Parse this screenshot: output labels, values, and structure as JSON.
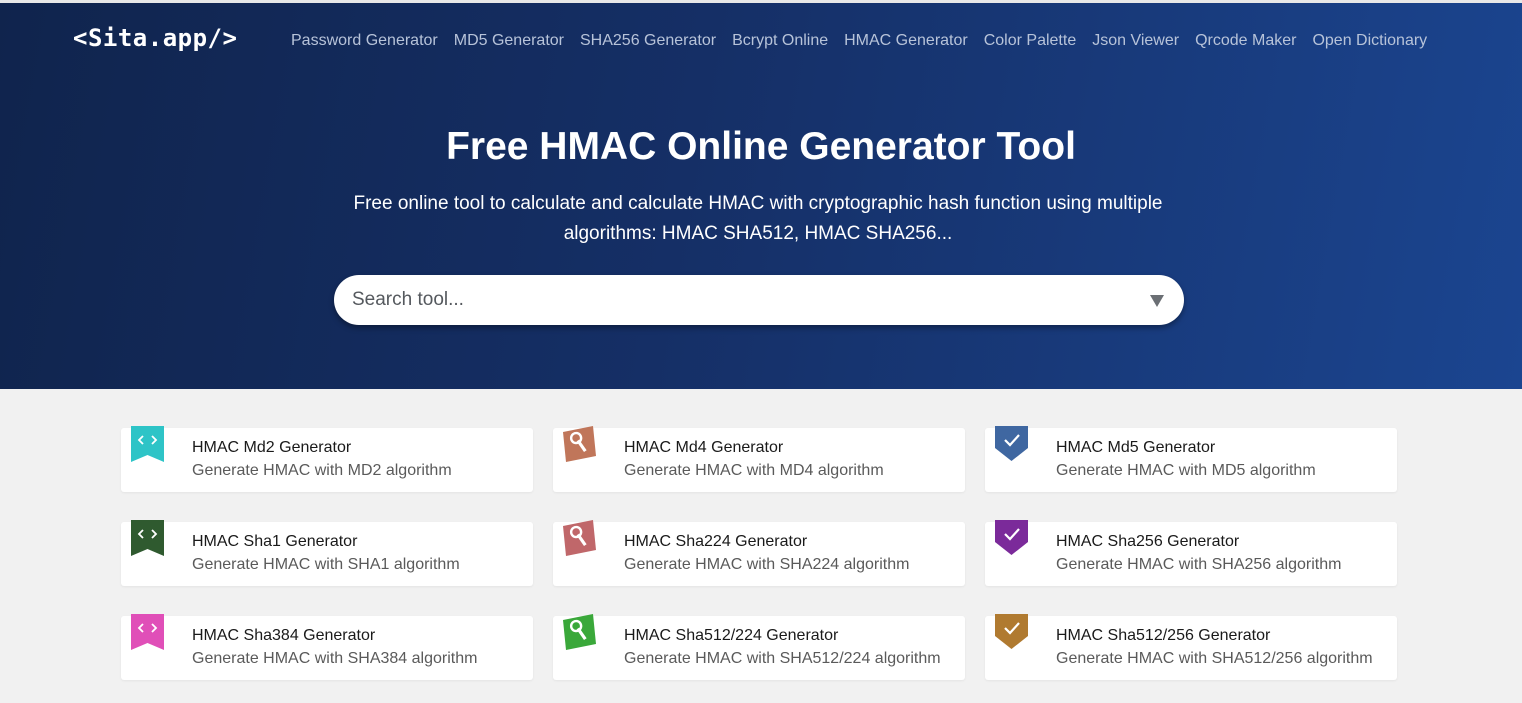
{
  "header": {
    "logo": "<Sita.app/>",
    "nav": [
      "Password Generator",
      "MD5 Generator",
      "SHA256 Generator",
      "Bcrypt Online",
      "HMAC Generator",
      "Color Palette",
      "Json Viewer",
      "Qrcode Maker",
      "Open Dictionary"
    ]
  },
  "hero": {
    "title": "Free HMAC Online Generator Tool",
    "subtitle_line1": "Free online tool to calculate and calculate HMAC with cryptographic hash function using multiple",
    "subtitle_line2": "algorithms: HMAC SHA512, HMAC SHA256..."
  },
  "search": {
    "placeholder": "Search tool..."
  },
  "tools": [
    {
      "title": "HMAC Md2 Generator",
      "desc": "Generate HMAC with MD2 algorithm",
      "icon": "code-icon",
      "shape": "ribbon",
      "color": "#2ec4c7"
    },
    {
      "title": "HMAC Md4 Generator",
      "desc": "Generate HMAC with MD4 algorithm",
      "icon": "wrench-icon",
      "shape": "tilted",
      "color": "#c0765a"
    },
    {
      "title": "HMAC Md5 Generator",
      "desc": "Generate HMAC with MD5 algorithm",
      "icon": "check-icon",
      "shape": "shield",
      "color": "#3f67a1"
    },
    {
      "title": "HMAC Sha1 Generator",
      "desc": "Generate HMAC with SHA1 algorithm",
      "icon": "code-icon",
      "shape": "ribbon",
      "color": "#2f5a2f"
    },
    {
      "title": "HMAC Sha224 Generator",
      "desc": "Generate HMAC with SHA224 algorithm",
      "icon": "wrench-icon",
      "shape": "tilted",
      "color": "#c0676a"
    },
    {
      "title": "HMAC Sha256 Generator",
      "desc": "Generate HMAC with SHA256 algorithm",
      "icon": "check-icon",
      "shape": "shield",
      "color": "#7b2a9a"
    },
    {
      "title": "HMAC Sha384 Generator",
      "desc": "Generate HMAC with SHA384 algorithm",
      "icon": "code-icon",
      "shape": "ribbon",
      "color": "#e04fb8"
    },
    {
      "title": "HMAC Sha512/224 Generator",
      "desc": "Generate HMAC with SHA512/224 algorithm",
      "icon": "wrench-icon",
      "shape": "tilted",
      "color": "#3aa83a"
    },
    {
      "title": "HMAC Sha512/256 Generator",
      "desc": "Generate HMAC with SHA512/256 algorithm",
      "icon": "check-icon",
      "shape": "shield",
      "color": "#b07a30"
    }
  ]
}
